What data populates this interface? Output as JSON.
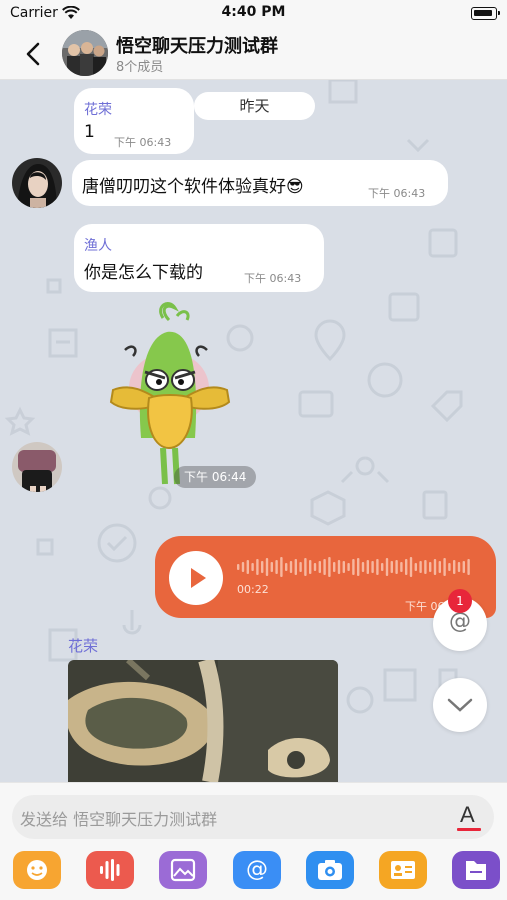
{
  "status": {
    "carrier": "Carrier",
    "time": "4:40 PM"
  },
  "header": {
    "title": "悟空聊天压力测试群",
    "members": "8个成员"
  },
  "chat": {
    "date_divider": "昨天",
    "messages": [
      {
        "sender": "花荣",
        "text": "1",
        "time": "下午 06:43"
      },
      {
        "text": "唐僧叨叨这个软件体验真好😎",
        "time": "下午 06:43"
      },
      {
        "sender": "渔人",
        "text": "你是怎么下载的",
        "time": "下午 06:43"
      },
      {
        "sticker": "duck-sticker",
        "time": "下午 06:44"
      },
      {
        "voice_duration": "00:22",
        "time": "下午 06:43"
      },
      {
        "sender": "花荣",
        "image": "photo"
      }
    ]
  },
  "floating": {
    "mention_icon": "@",
    "mention_badge": "1",
    "scroll_icon": "chevron-down-icon"
  },
  "input": {
    "placeholder": "发送给 悟空聊天压力测试群",
    "font_icon": "A"
  },
  "toolbar": [
    {
      "icon": "emoji-icon",
      "color": "#f7a531"
    },
    {
      "icon": "voice-icon",
      "color": "#ec5a4e"
    },
    {
      "icon": "image-icon",
      "color": "#9b6bd6"
    },
    {
      "icon": "mention-icon",
      "color": "#3a8ef5",
      "glyph": "@"
    },
    {
      "icon": "camera-icon",
      "color": "#2f8ff0"
    },
    {
      "icon": "card-icon",
      "color": "#f5a623"
    },
    {
      "icon": "file-icon",
      "color": "#7b4fc9"
    }
  ],
  "colors": {
    "accent": "#e8663d",
    "sender_name": "#6f6fd6",
    "badge": "#e8263a"
  }
}
